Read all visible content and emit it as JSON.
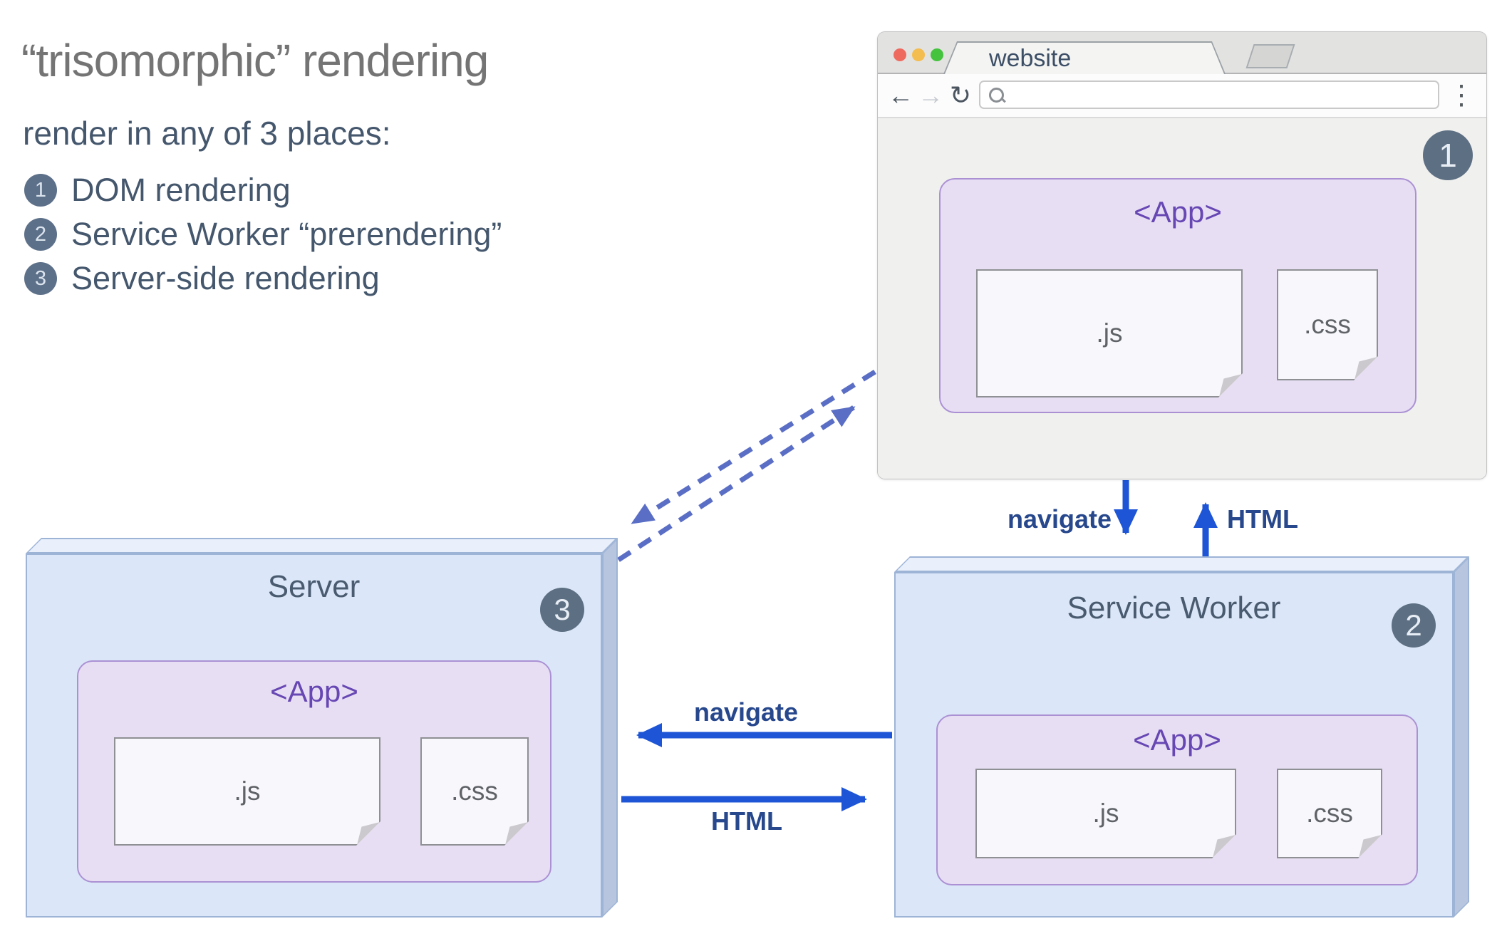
{
  "title": "“trisomorphic” rendering",
  "subtitle": "render in any of 3 places:",
  "legend": [
    {
      "num": "1",
      "label": "DOM rendering"
    },
    {
      "num": "2",
      "label": "Service Worker “prerendering”"
    },
    {
      "num": "3",
      "label": "Server-side rendering"
    }
  ],
  "browser": {
    "tab_title": "website",
    "badge": "1",
    "toolbar": {
      "back_icon": "←",
      "forward_icon": "→",
      "reload_icon": "↻",
      "menu_icon": "⋮"
    },
    "url_value": "",
    "app": {
      "title": "<App>",
      "files": [
        {
          "label": ".js"
        },
        {
          "label": ".css"
        }
      ]
    }
  },
  "server": {
    "title": "Server",
    "badge": "3",
    "app": {
      "title": "<App>",
      "files": [
        {
          "label": ".js"
        },
        {
          "label": ".css"
        }
      ]
    }
  },
  "service_worker": {
    "title": "Service Worker",
    "badge": "2",
    "app": {
      "title": "<App>",
      "files": [
        {
          "label": ".js"
        },
        {
          "label": ".css"
        }
      ]
    }
  },
  "arrows": {
    "browser_to_sw": "navigate",
    "sw_to_browser": "HTML",
    "sw_to_server": "navigate",
    "server_to_sw": "HTML"
  },
  "colors": {
    "accent_blue": "#1d55d6",
    "dashed_blue": "#5a6ec5",
    "arrow_label_blue": "#27488c",
    "box_blue": "#dbe7f8",
    "app_lavender": "#e7def3",
    "app_purple": "#6747b3",
    "badge_slate": "#5d6f83",
    "traffic_red": "#ee6a5f",
    "traffic_yellow": "#f4bd4f",
    "traffic_green": "#45c33e"
  }
}
